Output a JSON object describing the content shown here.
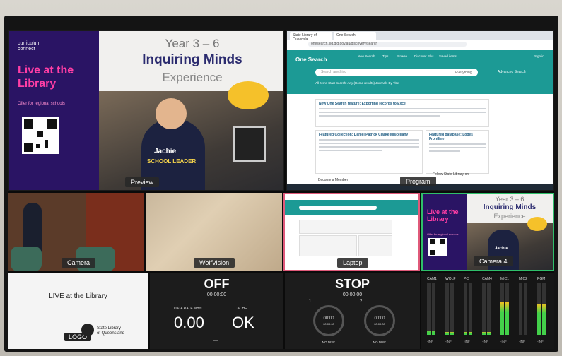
{
  "preview": {
    "label": "Preview",
    "brand_line1": "curriculum",
    "brand_line2": "connect",
    "live_title": "Live at the Library",
    "offer": "Offer for regional schools",
    "year": "Year 3 – 6",
    "title": "Inquiring Minds",
    "subtitle": "Experience",
    "shirt_name": "Jachie",
    "shirt_text": "SCHOOL LEADER"
  },
  "program": {
    "label": "Program",
    "tabs": [
      "State Library of Queensla...",
      "One Search"
    ],
    "address": "onesearch.slq.qld.gov.au/discovery/search",
    "site_title": "One Search",
    "nav": [
      "New Search",
      "Tips",
      "Browse",
      "Discover Plus",
      "Saved items",
      "Sign in"
    ],
    "search_placeholder": "Search anything",
    "search_scope": "Everything",
    "advanced": "Advanced Search",
    "filters": "All items   Start Search: Any (Home results)   Journals By Title",
    "news_title": "New One Search feature: Exporting records to Excel",
    "featured_title": "Featured Collection: Daniel Patrick Clarke Miscellany",
    "featured2_title": "Featured database: Lodes Frontline",
    "follow": "Follow State Library on",
    "member": "Become a Member"
  },
  "camera": {
    "label": "Camera"
  },
  "wolfvision": {
    "label": "WolfVision"
  },
  "laptop": {
    "label": "Laptop"
  },
  "camera4": {
    "label": "Camera 4",
    "year": "Year 3 – 6",
    "title": "Inquiring Minds",
    "subtitle": "Experience",
    "live_title": "Live at the Library",
    "offer": "Offer for regional schools",
    "shirt_name": "Jachie"
  },
  "live_tile": {
    "title": "LIVE at the Library",
    "logo": "LOGO",
    "org_line1": "State Library",
    "org_line2": "of Queensland"
  },
  "record": {
    "status": "OFF",
    "time": "00:00:00",
    "data_label": "DATA RATE MB/s",
    "data_value": "0.00",
    "cache_label": "CACHE",
    "cache_value": "OK",
    "footer": "---"
  },
  "stream": {
    "status": "STOP",
    "time": "00:00:00",
    "disk1": "1",
    "disk2": "2",
    "disk_time": "00:00",
    "disk_sub": "00:00:00",
    "no_disk": "NO DISK"
  },
  "audio": {
    "channels": [
      {
        "name": "CAM1",
        "level": 0.08
      },
      {
        "name": "WOLF",
        "level": 0.06
      },
      {
        "name": "PC",
        "level": 0.05
      },
      {
        "name": "CAM4",
        "level": 0.05
      },
      {
        "name": "MIC1",
        "level": 0.62
      },
      {
        "name": "MIC2",
        "level": 0.0
      },
      {
        "name": "PGM",
        "level": 0.6
      }
    ],
    "readout": "-INF"
  },
  "colors": {
    "brand_purple": "#2a1464",
    "brand_pink": "#ff3ea5",
    "onesearch_teal": "#1c9a95",
    "laptop_border": "#e05a7a",
    "camera4_border": "#2fbf6a"
  }
}
